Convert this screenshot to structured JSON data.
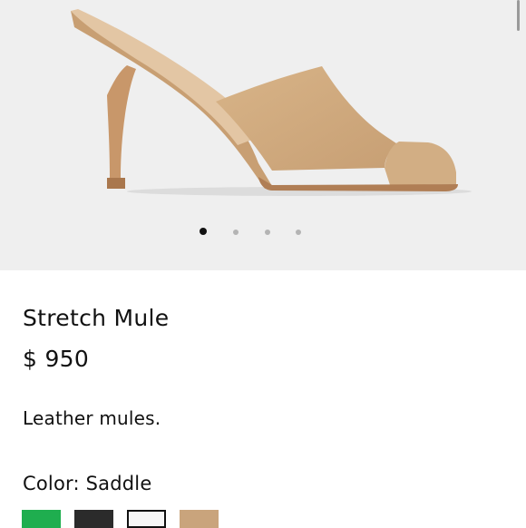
{
  "product": {
    "title": "Stretch Mule",
    "price": "$ 950",
    "description": "Leather mules."
  },
  "gallery": {
    "image_count": 4,
    "active_index": 0
  },
  "color": {
    "label": "Color:",
    "selected": "Saddle",
    "swatches": [
      {
        "name": "green",
        "hex": "#1fae4f"
      },
      {
        "name": "black",
        "hex": "#2b2b2b"
      },
      {
        "name": "white",
        "hex": "#f7f7f7"
      },
      {
        "name": "saddle",
        "hex": "#c9a47c"
      }
    ]
  }
}
